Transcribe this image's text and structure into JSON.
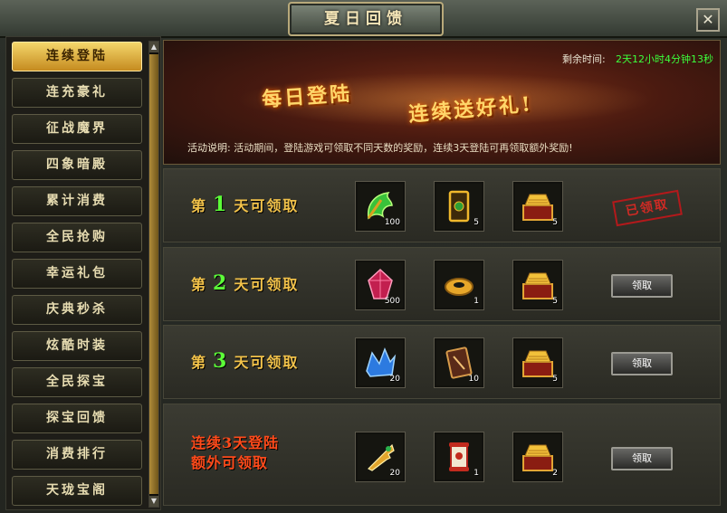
{
  "window": {
    "title": "夏日回馈",
    "close_icon": "close-icon"
  },
  "sidebar": {
    "items": [
      {
        "label": "连续登陆",
        "active": true
      },
      {
        "label": "连充豪礼"
      },
      {
        "label": "征战魔界"
      },
      {
        "label": "四象暗殿"
      },
      {
        "label": "累计消费"
      },
      {
        "label": "全民抢购"
      },
      {
        "label": "幸运礼包"
      },
      {
        "label": "庆典秒杀"
      },
      {
        "label": "炫酷时装"
      },
      {
        "label": "全民探宝"
      },
      {
        "label": "探宝回馈"
      },
      {
        "label": "消费排行"
      },
      {
        "label": "天珑宝阁"
      }
    ]
  },
  "banner": {
    "remaining_label": "剩余时间:",
    "remaining_value": "2天12小时4分钟13秒",
    "slogan_1": "每日登陆",
    "slogan_2": "连续送好礼!",
    "desc_label": "活动说明:",
    "desc_text": "活动期间，登陆游戏可领取不同天数的奖励，连续3天登陆可再领取额外奖励!"
  },
  "rows": [
    {
      "prefix": "第",
      "day": "1",
      "suffix": "天可领取",
      "items": [
        {
          "icon": "green-wing-icon",
          "count": "100"
        },
        {
          "icon": "gold-card-icon",
          "count": "5"
        },
        {
          "icon": "gold-chest-icon",
          "count": "5"
        }
      ],
      "status": "已领取"
    },
    {
      "prefix": "第",
      "day": "2",
      "suffix": "天可领取",
      "items": [
        {
          "icon": "red-crystal-icon",
          "count": "500"
        },
        {
          "icon": "gold-ring-icon",
          "count": "1"
        },
        {
          "icon": "gold-chest-icon",
          "count": "5"
        }
      ],
      "button": "领取"
    },
    {
      "prefix": "第",
      "day": "3",
      "suffix": "天可领取",
      "items": [
        {
          "icon": "blue-crystal-icon",
          "count": "20"
        },
        {
          "icon": "skill-book-icon",
          "count": "10"
        },
        {
          "icon": "gold-chest-icon",
          "count": "5"
        }
      ],
      "button": "领取"
    },
    {
      "title_line_1": "连续3天登陆",
      "title_line_2": "额外可领取",
      "items": [
        {
          "icon": "gold-key-icon",
          "count": "20"
        },
        {
          "icon": "red-scroll-icon",
          "count": "1"
        },
        {
          "icon": "gold-chest-icon",
          "count": "2"
        }
      ],
      "button": "领取"
    }
  ],
  "colors": {
    "accent_gold": "#f2c24a",
    "day_number": "#5cff38",
    "timer": "#3cff3c",
    "stamp_red": "#cf2a24"
  }
}
